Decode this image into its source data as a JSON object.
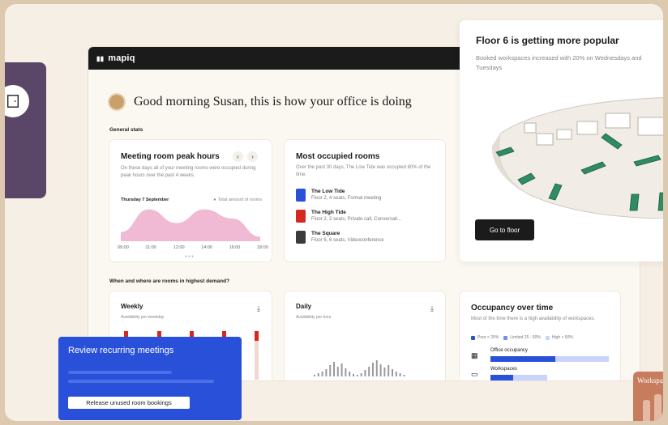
{
  "colors": {
    "accent_blue": "#2950d9",
    "pink": "#e37fb0",
    "red_bar": "#d3291f",
    "dark": "#1c1b1c",
    "purple": "#5a4767",
    "orange": "#c77c5e",
    "green_desk": "#2e8b63"
  },
  "app": {
    "logo": "mapiq"
  },
  "greeting": "Good morning Susan, this is how your office is doing",
  "general_stats_label": "General stats",
  "peak": {
    "title": "Meeting room peak hours",
    "description": "On these days all of your meeting rooms were occupied during peak hours over the past 4 weeks.",
    "day": "Thursday 7 September",
    "legend": "Total amount of rooms",
    "prev_icon": "chevron-left-icon",
    "next_icon": "chevron-right-icon"
  },
  "chart_data": {
    "type": "area",
    "x": [
      "09:00",
      "11:00",
      "12:00",
      "14:00",
      "16:00",
      "18:00"
    ],
    "series": [
      {
        "values": [
          2,
          7,
          4,
          7,
          5,
          1
        ]
      }
    ]
  },
  "occupied": {
    "title": "Most occupied rooms",
    "description": "Over the past 30 days, The Low Tide was occupied 80% of the time.",
    "rooms": [
      {
        "name": "The Low Tide",
        "details": "Floor 2, 4 seats, Formal meeting",
        "color": "#2950d9"
      },
      {
        "name": "The High Tide",
        "details": "Floor 2, 2 seats, Private call, Conversati...",
        "color": "#d3291f"
      },
      {
        "name": "The Square",
        "details": "Floor 6, 6 seats, Videoconference",
        "color": "#3b3b3b"
      }
    ]
  },
  "demand_label": "When and where are rooms in highest demand?",
  "weekly": {
    "title": "Weekly",
    "subtitle": "Availability per weekday"
  },
  "daily": {
    "title": "Daily",
    "subtitle": "Availability per hour"
  },
  "occupancy": {
    "title": "Occupancy over time",
    "description": "Most of the time there is a high availability of workspaces.",
    "legend": [
      "Poor < 25%",
      "Limited 25 - 50%",
      "High > 50%"
    ],
    "rows": [
      {
        "label": "Office occupancy",
        "fill_fraction": 0.55
      },
      {
        "label": "Workspaces",
        "fill_fraction": 0.4
      }
    ]
  },
  "floor": {
    "title": "Floor 6 is getting more popular",
    "description": "Booked workspaces increased with 20% on Wednesdays and Tuesdays",
    "button": "Go to floor"
  },
  "review": {
    "title": "Review recurring meetings",
    "button": "Release unused room bookings"
  },
  "side_tab": {
    "label": "Workspa"
  }
}
